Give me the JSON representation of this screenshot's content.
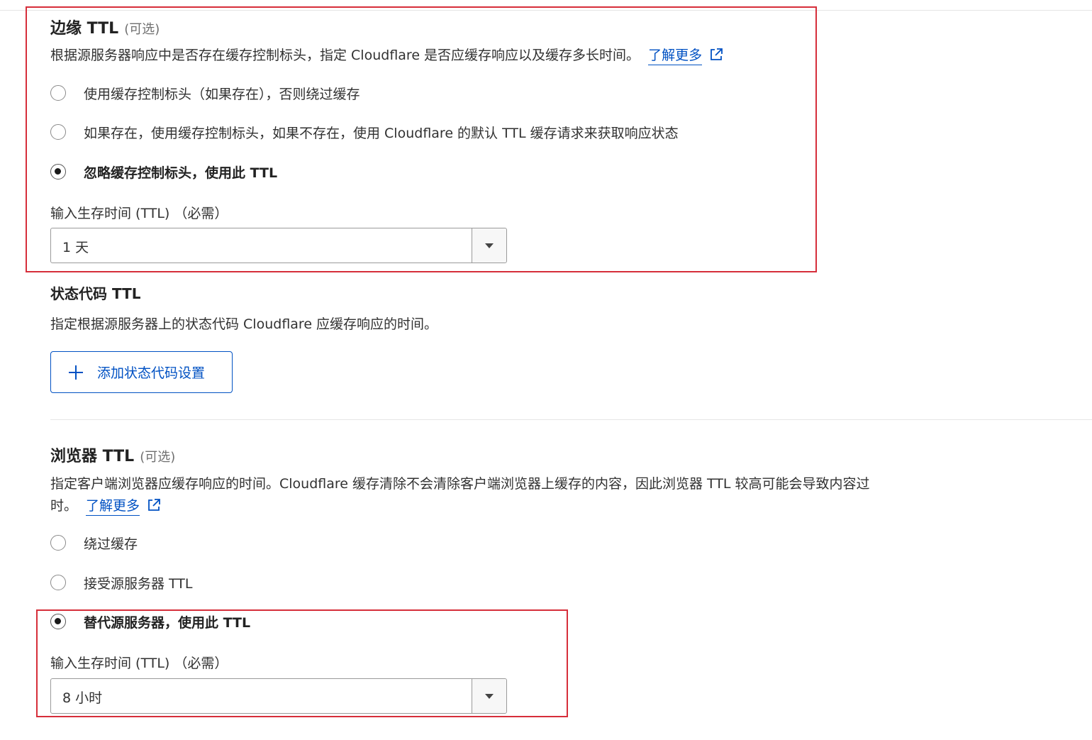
{
  "edge_ttl": {
    "title": "边缘 TTL",
    "optional": "(可选)",
    "description": "根据源服务器响应中是否存在缓存控制标头，指定 Cloudflare 是否应缓存响应以及缓存多长时间。",
    "learn_more": "了解更多",
    "options": [
      {
        "label": "使用缓存控制标头（如果存在），否则绕过缓存",
        "checked": false
      },
      {
        "label": "如果存在，使用缓存控制标头，如果不存在，使用 Cloudflare 的默认 TTL 缓存请求来获取响应状态",
        "checked": false
      },
      {
        "label": "忽略缓存控制标头，使用此 TTL",
        "checked": true
      }
    ],
    "ttl_label": "输入生存时间 (TTL) （必需）",
    "ttl_value": "1 天"
  },
  "status_code_ttl": {
    "title": "状态代码 TTL",
    "description": "指定根据源服务器上的状态代码 Cloudflare 应缓存响应的时间。",
    "add_button": "添加状态代码设置"
  },
  "browser_ttl": {
    "title": "浏览器 TTL",
    "optional": "(可选)",
    "description_line1": "指定客户端浏览器应缓存响应的时间。Cloudflare 缓存清除不会清除客户端浏览器上缓存的内容，因此浏览器 TTL 较高可能会导致内容过",
    "description_line2": "时。",
    "learn_more": "了解更多",
    "options": [
      {
        "label": "绕过缓存",
        "checked": false
      },
      {
        "label": "接受源服务器 TTL",
        "checked": false
      },
      {
        "label": "替代源服务器，使用此 TTL",
        "checked": true
      }
    ],
    "ttl_label": "输入生存时间 (TTL) （必需）",
    "ttl_value": "8 小时"
  },
  "colors": {
    "link": "#0051c3",
    "highlight": "#d62e3a"
  },
  "icons": [
    "external-link-icon",
    "plus-icon",
    "caret-down-icon"
  ]
}
